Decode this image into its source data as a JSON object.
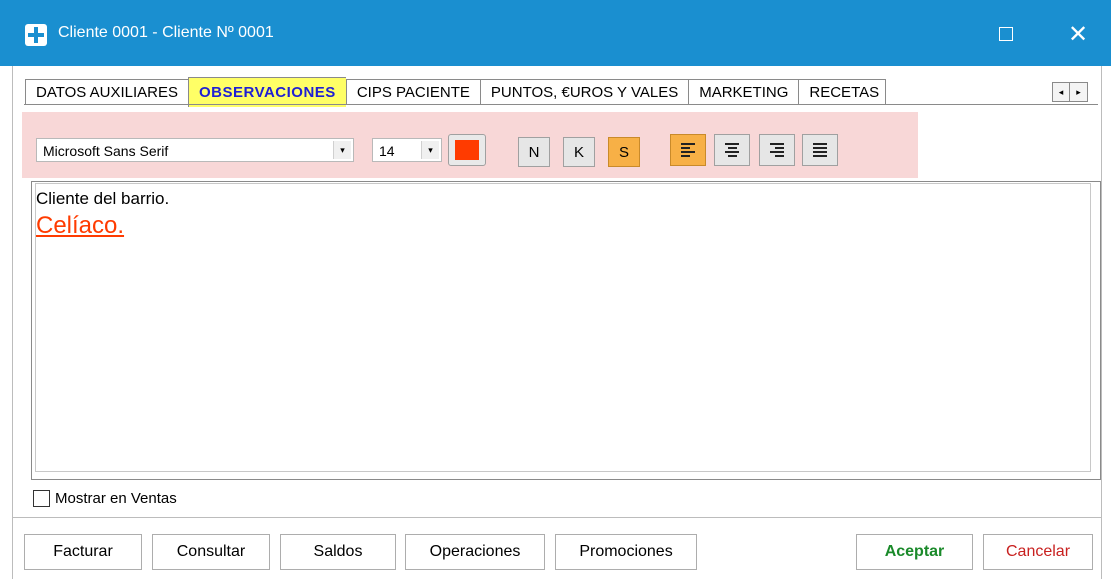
{
  "window": {
    "title": "Cliente  0001 - Cliente Nº 0001",
    "maximize_glyph": "",
    "close_glyph": "✕"
  },
  "tabs": [
    {
      "label": "DATOS AUXILIARES",
      "active": false
    },
    {
      "label": "OBSERVACIONES",
      "active": true
    },
    {
      "label": "CIPS PACIENTE",
      "active": false
    },
    {
      "label": "PUNTOS, €UROS Y VALES",
      "active": false
    },
    {
      "label": "MARKETING",
      "active": false
    },
    {
      "label": "RECETAS",
      "active": false
    }
  ],
  "tab_scroll": {
    "left": "◂",
    "right": "▸"
  },
  "toolbar": {
    "font_value": "Microsoft Sans Serif",
    "size_value": "14",
    "dropdown_glyph": "▾",
    "text_color": "#ff3b00",
    "bold_label": "N",
    "italic_label": "K",
    "underline_label": "S",
    "underline_active": true,
    "align_active": "left",
    "highlight_color": "#f8d7d7"
  },
  "editor": {
    "line1": "Cliente del barrio.",
    "line2": "Celíaco."
  },
  "mostrar_ventas": {
    "label": "Mostrar en Ventas",
    "checked": false
  },
  "buttons": {
    "facturar": "Facturar",
    "consultar": "Consultar",
    "saldos": "Saldos",
    "operaciones": "Operaciones",
    "promociones": "Promociones",
    "aceptar": "Aceptar",
    "cancelar": "Cancelar"
  },
  "colors": {
    "titlebar": "#1a8fd0",
    "active_tab_bg": "#ffff66",
    "active_tab_text": "#1f1fd4",
    "active_format_button": "#f7b046",
    "accept_text": "#1a8a2a",
    "cancel_text": "#c8201f"
  }
}
